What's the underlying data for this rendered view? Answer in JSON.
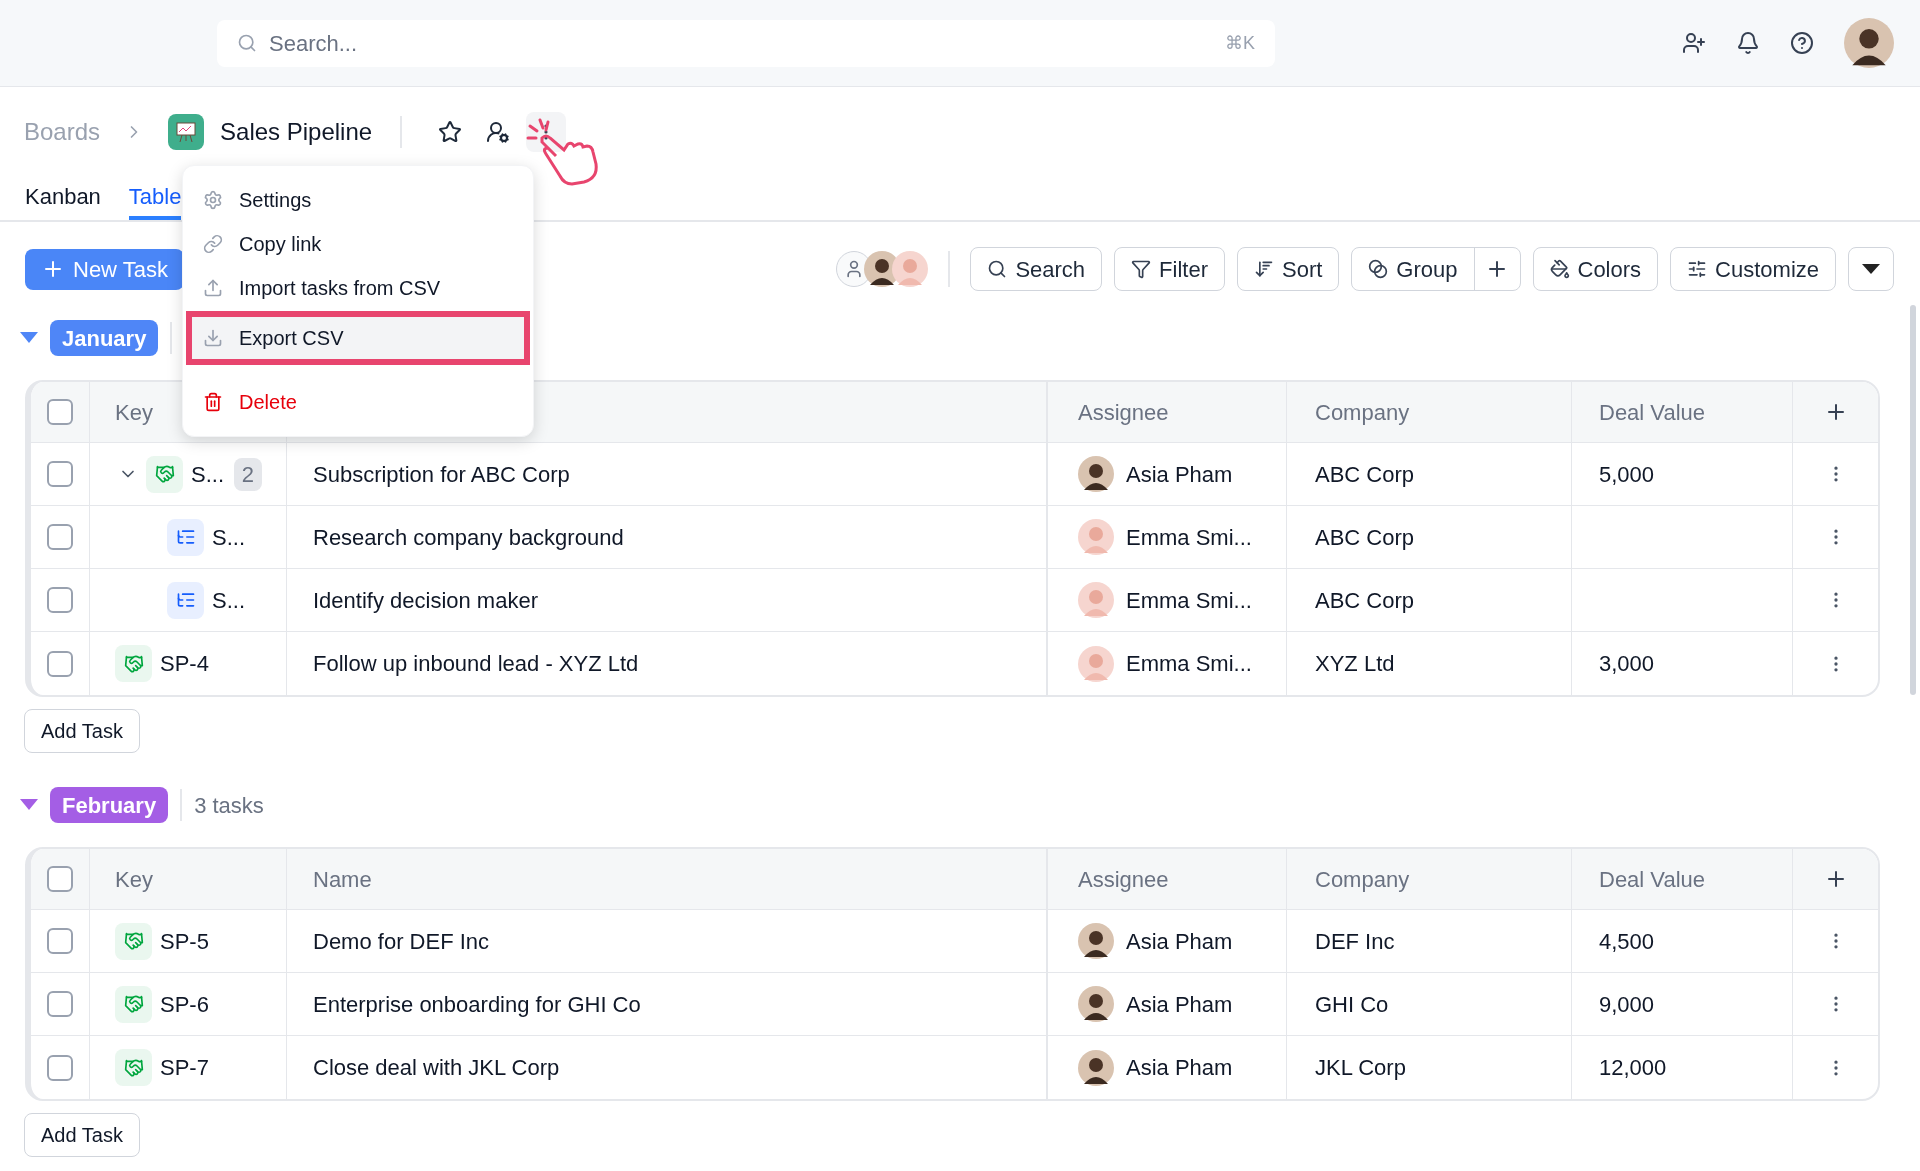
{
  "topbar": {
    "search": {
      "placeholder": "Search...",
      "shortcut": "⌘K"
    }
  },
  "breadcrumb": {
    "parent": "Boards",
    "title": "Sales Pipeline"
  },
  "tabs": [
    {
      "label": "Kanban",
      "selected": false
    },
    {
      "label": "Table",
      "selected": true
    }
  ],
  "new_task_button": "New Task",
  "menu": {
    "items": [
      {
        "label": "Settings",
        "kind": "settings",
        "highlighted": false
      },
      {
        "label": "Copy link",
        "kind": "link",
        "highlighted": false
      },
      {
        "label": "Import tasks from CSV",
        "kind": "import",
        "highlighted": false
      },
      {
        "label": "Export CSV",
        "kind": "export",
        "highlighted": true
      },
      {
        "label": "Delete",
        "kind": "delete",
        "highlighted": false
      }
    ]
  },
  "toolbar": {
    "buttons": [
      {
        "label": "Search",
        "kind": "search"
      },
      {
        "label": "Filter",
        "kind": "filter"
      },
      {
        "label": "Sort",
        "kind": "sort"
      },
      {
        "label": "Group",
        "kind": "group"
      },
      {
        "label": "Colors",
        "kind": "colors"
      },
      {
        "label": "Customize",
        "kind": "customize"
      }
    ]
  },
  "groups": [
    {
      "label": "January",
      "color": "#4f86f7",
      "expanded": true,
      "header_checked": false,
      "headers": {
        "key": "Key",
        "assignee": "Assignee",
        "company": "Company",
        "deal_value": "Deal Value"
      },
      "rows": [
        {
          "kind": "task",
          "checked": false,
          "key": "S...",
          "name": "Subscription for ABC Corp",
          "assignee": "Asia Pham",
          "company": "ABC Corp",
          "deal_value": "5,000",
          "expanded": true,
          "subtask_count": "2",
          "children": [
            {
              "kind": "subtask",
              "checked": false,
              "key": "S...",
              "name": "Research company background",
              "assignee": "Emma Smi...",
              "company": "ABC Corp"
            },
            {
              "kind": "subtask",
              "checked": false,
              "key": "S...",
              "name": "Identify decision maker",
              "assignee": "Emma Smi...",
              "company": "ABC Corp"
            }
          ]
        },
        {
          "kind": "task",
          "checked": false,
          "key": "SP-4",
          "name": "Follow up inbound lead - XYZ Ltd",
          "assignee": "Emma Smi...",
          "company": "XYZ Ltd",
          "deal_value": "3,000"
        }
      ],
      "add_button": "Add Task"
    },
    {
      "label": "February",
      "color": "#a45ee5",
      "expanded": true,
      "count": "3 tasks",
      "header_checked": false,
      "headers": {
        "key": "Key",
        "name": "Name",
        "assignee": "Assignee",
        "company": "Company",
        "deal_value": "Deal Value"
      },
      "rows": [
        {
          "kind": "task",
          "checked": false,
          "key": "SP-5",
          "name": "Demo for DEF Inc",
          "assignee": "Asia Pham",
          "company": "DEF Inc",
          "deal_value": "4,500"
        },
        {
          "kind": "task",
          "checked": false,
          "key": "SP-6",
          "name": "Enterprise onboarding for GHI Co",
          "assignee": "Asia Pham",
          "company": "GHI Co",
          "deal_value": "9,000"
        },
        {
          "kind": "task",
          "checked": false,
          "key": "SP-7",
          "name": "Close deal with JKL Corp",
          "assignee": "Asia Pham",
          "company": "JKL Corp",
          "deal_value": "12,000"
        }
      ],
      "add_button": "Add Task"
    }
  ]
}
